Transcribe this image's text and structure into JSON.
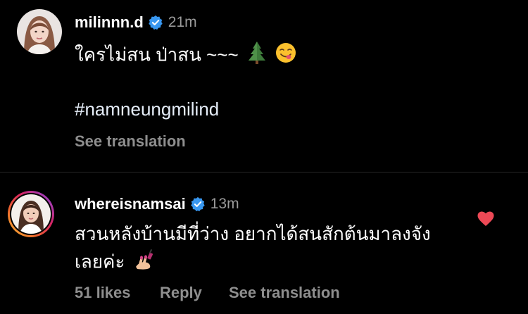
{
  "post": {
    "username": "milinnn.d",
    "timestamp": "21m",
    "caption_text": "ใครไม่สน ป่าสน ~~~",
    "caption_emojis": [
      "tree-icon",
      "yum-face-icon"
    ],
    "hashtag": "#namneungmilind",
    "see_translation": "See translation"
  },
  "comment": {
    "username": "whereisnamsai",
    "timestamp": "13m",
    "line1": "สวนหลังบ้านมีที่ว่าง อยากได้สนสักต้นมาลงจัง",
    "line2": "เลยค่ะ",
    "line2_emoji": "nail-polish-icon",
    "likes": "51 likes",
    "reply": "Reply",
    "see_translation": "See translation",
    "liked": true
  },
  "colors": {
    "background": "#000000",
    "verified_badge": "#3897f0",
    "heart": "#ed4956",
    "muted_text": "#8e8e8e"
  }
}
